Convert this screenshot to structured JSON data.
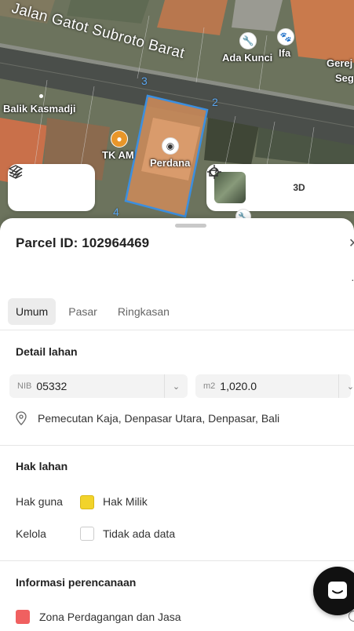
{
  "map": {
    "street": "Jalan Gatot Subroto Barat",
    "pois": {
      "ada_kunci": "Ada Kunci",
      "ifa": "Ifa",
      "gereja": "Gerej",
      "gereja_line2": "Seg",
      "balik_kasmadji": "Balik Kasmadji",
      "tk_am": "TK AM",
      "perdana": "Perdana"
    },
    "vertices": {
      "v2": "2",
      "v3": "3",
      "v4": "4"
    },
    "controls": {
      "three_d": "3D"
    }
  },
  "sheet": {
    "title": "Parcel ID: 102964469",
    "tabs": [
      {
        "label": "Umum",
        "active": true
      },
      {
        "label": "Pasar",
        "active": false
      },
      {
        "label": "Ringkasan",
        "active": false
      }
    ],
    "detail": {
      "title": "Detail lahan",
      "nib_prefix": "NIB",
      "nib_value": "05332",
      "area_prefix": "m2",
      "area_value": "1,020.0",
      "address": "Pemecutan Kaja, Denpasar Utara, Denpasar, Bali"
    },
    "hak": {
      "title": "Hak lahan",
      "guna_label": "Hak guna",
      "guna_value": "Hak Milik",
      "guna_color": "#f2d32a",
      "kelola_label": "Kelola",
      "kelola_value": "Tidak ada data"
    },
    "perencanaan": {
      "title": "Informasi perencanaan",
      "zona_label": "Zona Perdagangan dan Jasa",
      "zona_color": "#f06060"
    }
  },
  "colors": {
    "parcel_outline": "#3b8fe0"
  }
}
